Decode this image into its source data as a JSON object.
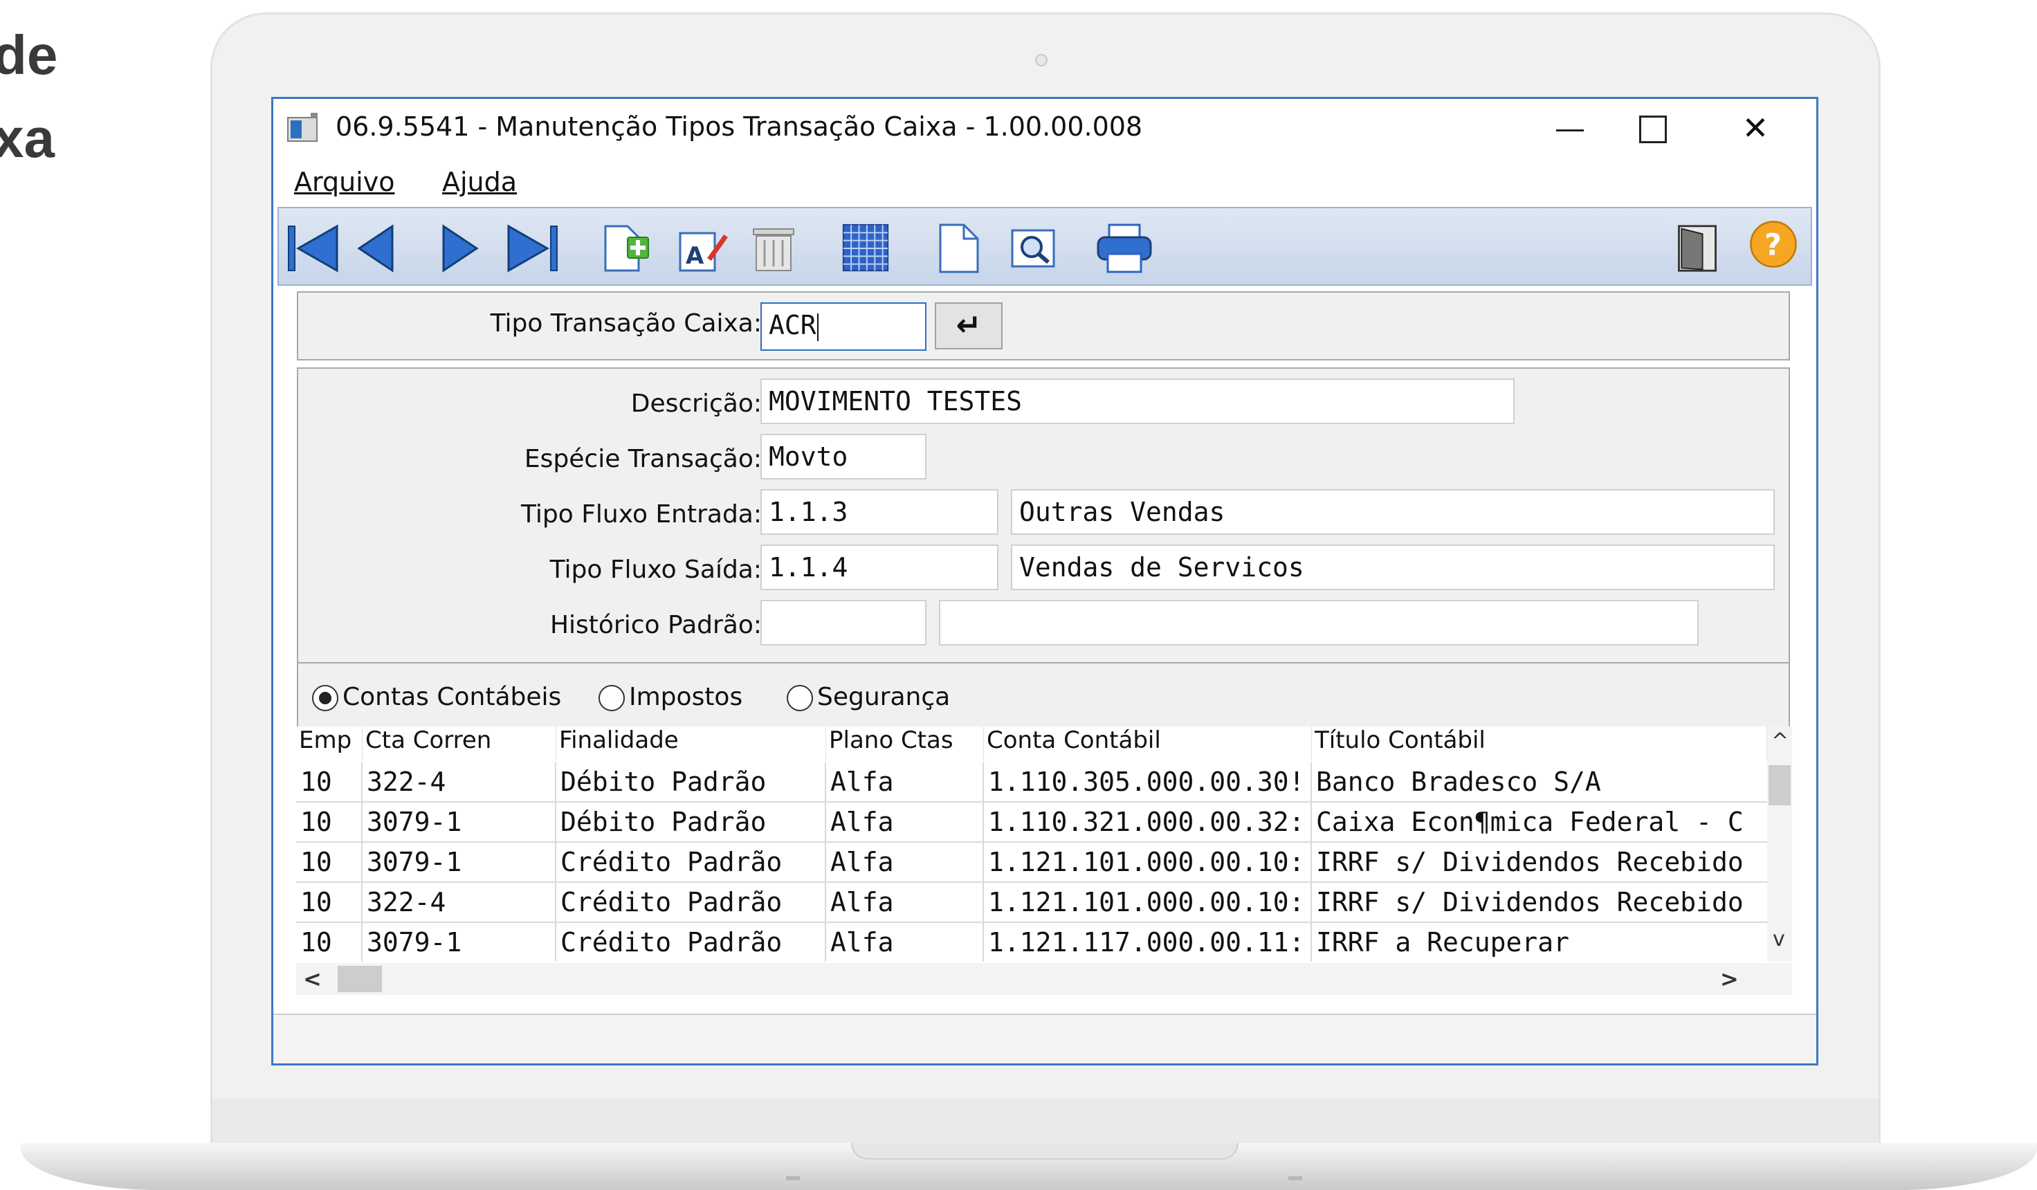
{
  "page": {
    "side_title_lines": [
      "de",
      "xa"
    ]
  },
  "window": {
    "title": "06.9.5541 - Manutenção Tipos Transação Caixa - 1.00.00.008",
    "controls": {
      "close": "✕"
    }
  },
  "menu": {
    "items": [
      {
        "label": "Arquivo"
      },
      {
        "label": "Ajuda"
      }
    ]
  },
  "toolbar": {
    "icons": [
      "first-record-icon",
      "previous-record-icon",
      "next-record-icon",
      "last-record-icon",
      "new-record-icon",
      "edit-record-icon",
      "delete-record-icon",
      "calendar-grid-icon",
      "blank-document-icon",
      "preview-icon",
      "print-icon",
      "exit-door-icon",
      "help-icon"
    ]
  },
  "header": {
    "tipo_label": "Tipo Transação Caixa:",
    "tipo_value": "ACR",
    "go_button": "↵"
  },
  "form": {
    "descricao": {
      "label": "Descrição:",
      "value": "MOVIMENTO TESTES"
    },
    "especie": {
      "label": "Espécie Transação:",
      "value": "Movto"
    },
    "fluxo_entrada": {
      "label": "Tipo Fluxo Entrada:",
      "code": "1.1.3",
      "desc": "Outras Vendas"
    },
    "fluxo_saida": {
      "label": "Tipo Fluxo Saída:",
      "code": "1.1.4",
      "desc": "Vendas de Servicos"
    },
    "historico": {
      "label": "Histórico Padrão:",
      "code": "",
      "desc": ""
    }
  },
  "tabs": {
    "options": [
      {
        "label": "Contas Contábeis",
        "selected": true
      },
      {
        "label": "Impostos",
        "selected": false
      },
      {
        "label": "Segurança",
        "selected": false
      }
    ]
  },
  "table": {
    "columns": [
      "Emp",
      "Cta Corren",
      "Finalidade",
      "Plano Ctas",
      "Conta Contábil",
      "Título Contábil"
    ],
    "rows": [
      [
        "10",
        "322-4",
        "Débito Padrão",
        "Alfa",
        "1.110.305.000.00.30!",
        "Banco Bradesco S/A"
      ],
      [
        "10",
        "3079-1",
        "Débito Padrão",
        "Alfa",
        "1.110.321.000.00.32:",
        "Caixa Econ¶mica Federal - C"
      ],
      [
        "10",
        "3079-1",
        "Crédito Padrão",
        "Alfa",
        "1.121.101.000.00.10:",
        "IRRF s/ Dividendos Recebido"
      ],
      [
        "10",
        "322-4",
        "Crédito Padrão",
        "Alfa",
        "1.121.101.000.00.10:",
        "IRRF s/ Dividendos Recebido"
      ],
      [
        "10",
        "3079-1",
        "Crédito Padrão",
        "Alfa",
        "1.121.117.000.00.11:",
        "IRRF a Recuperar"
      ]
    ],
    "scroll": {
      "up": "^",
      "down": "v",
      "left": "<",
      "right": ">"
    }
  },
  "colors": {
    "window_border": "#3a78c6",
    "toolbar_bg": "#c7d5ea",
    "toolbar_icon_blue": "#2f6fcf",
    "help_orange": "#f5a623"
  }
}
